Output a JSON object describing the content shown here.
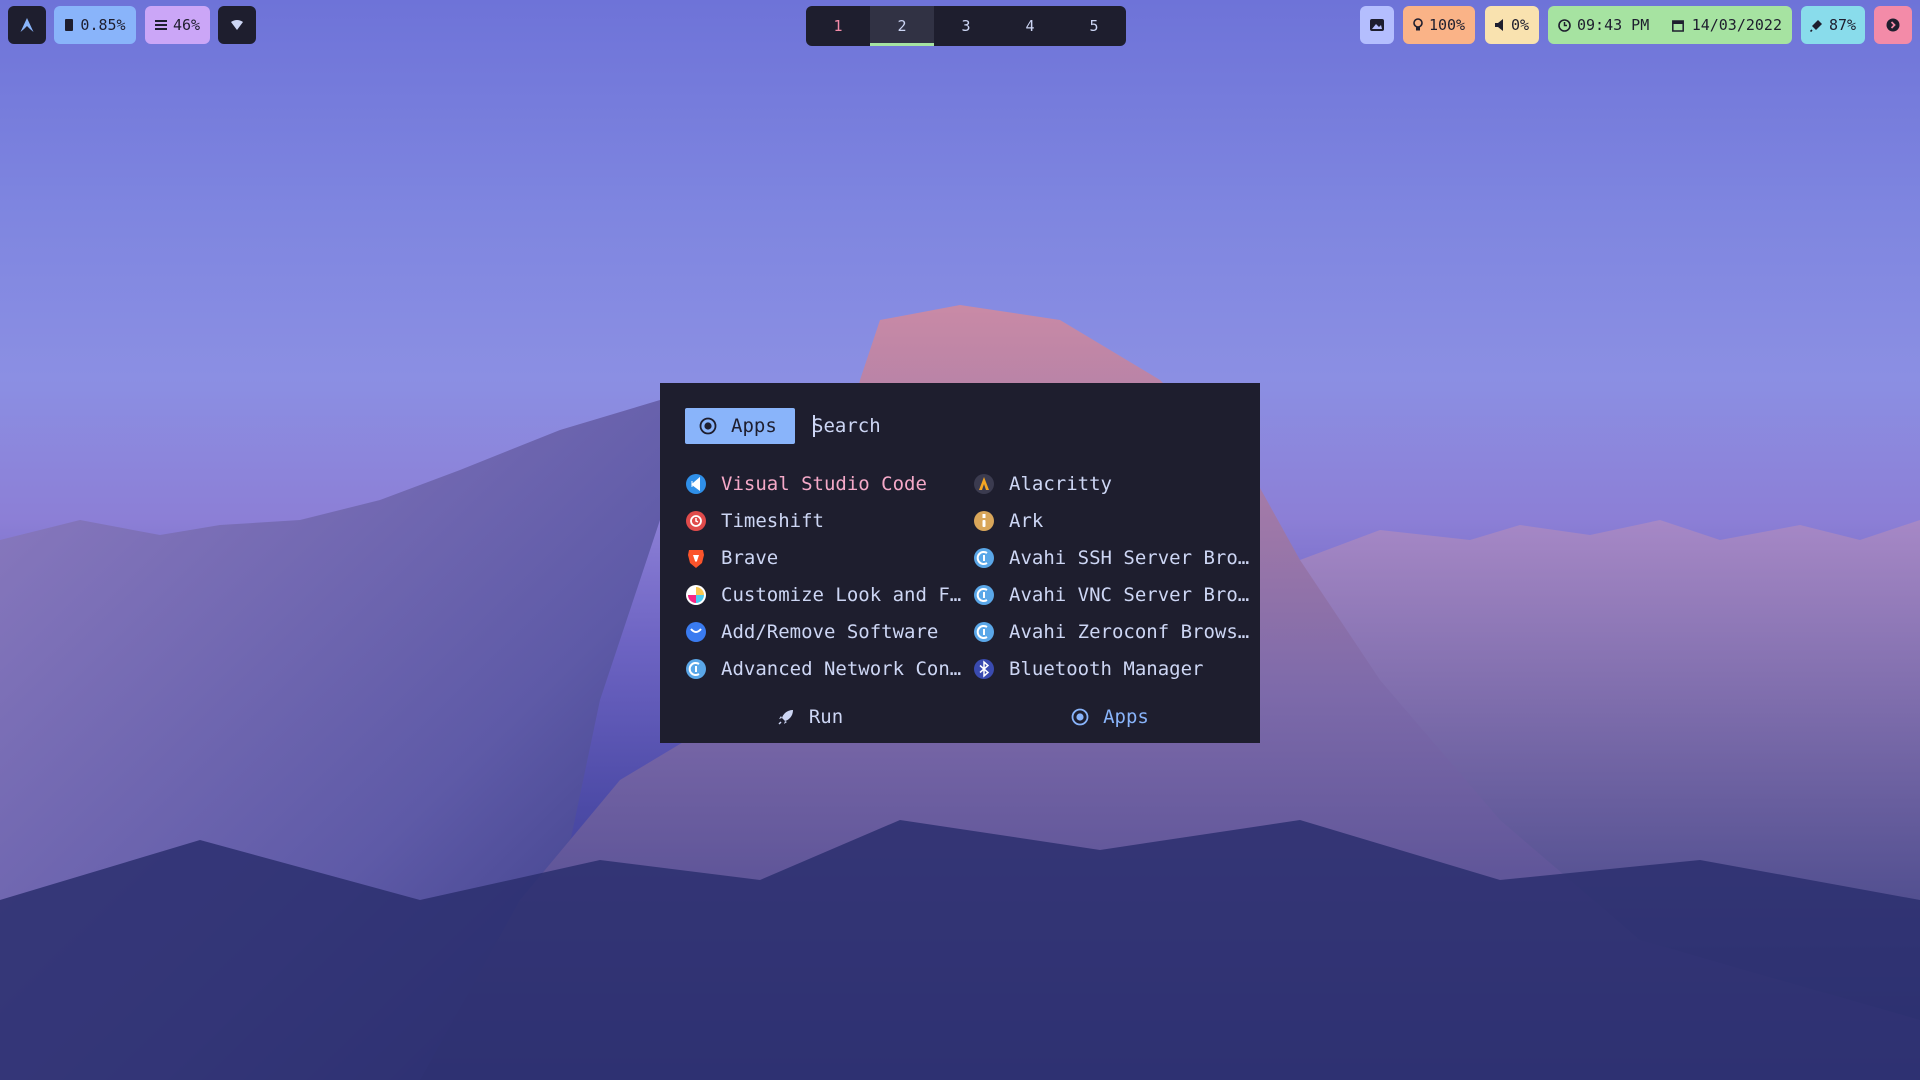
{
  "topbar": {
    "cpu": "0.85%",
    "memory": "46%",
    "workspaces": [
      {
        "label": "1",
        "state": "urgent"
      },
      {
        "label": "2",
        "state": "active"
      },
      {
        "label": "3",
        "state": "normal"
      },
      {
        "label": "4",
        "state": "normal"
      },
      {
        "label": "5",
        "state": "normal"
      }
    ],
    "brightness": "100%",
    "volume": "0%",
    "time": "09:43 PM",
    "date": "14/03/2022",
    "battery": "87%"
  },
  "launcher": {
    "mode_badge": "Apps",
    "search_placeholder": "Search",
    "apps_left": [
      {
        "label": "Visual Studio Code",
        "icon": "vscode-icon",
        "selected": true
      },
      {
        "label": "Timeshift",
        "icon": "timeshift-icon"
      },
      {
        "label": "Brave",
        "icon": "brave-icon"
      },
      {
        "label": "Customize Look and F…",
        "icon": "customize-icon"
      },
      {
        "label": "Add/Remove Software",
        "icon": "software-icon"
      },
      {
        "label": "Advanced Network Con…",
        "icon": "network-icon"
      }
    ],
    "apps_right": [
      {
        "label": "Alacritty",
        "icon": "alacritty-icon"
      },
      {
        "label": "Ark",
        "icon": "ark-icon"
      },
      {
        "label": "Avahi SSH Server Bro…",
        "icon": "avahi-icon"
      },
      {
        "label": "Avahi VNC Server Bro…",
        "icon": "avahi-icon"
      },
      {
        "label": "Avahi Zeroconf Brows…",
        "icon": "avahi-icon"
      },
      {
        "label": "Bluetooth Manager",
        "icon": "bluetooth-icon"
      }
    ],
    "modes": [
      {
        "label": "Run",
        "icon": "rocket-icon"
      },
      {
        "label": "Apps",
        "icon": "apps-icon",
        "active": true
      }
    ]
  },
  "colors": {
    "bar_dark": "#1e1e2e",
    "accent_blue": "#89b4fa",
    "accent_pink": "#f38ba8",
    "accent_green": "#a6e3a1",
    "text": "#cdd6f4"
  }
}
